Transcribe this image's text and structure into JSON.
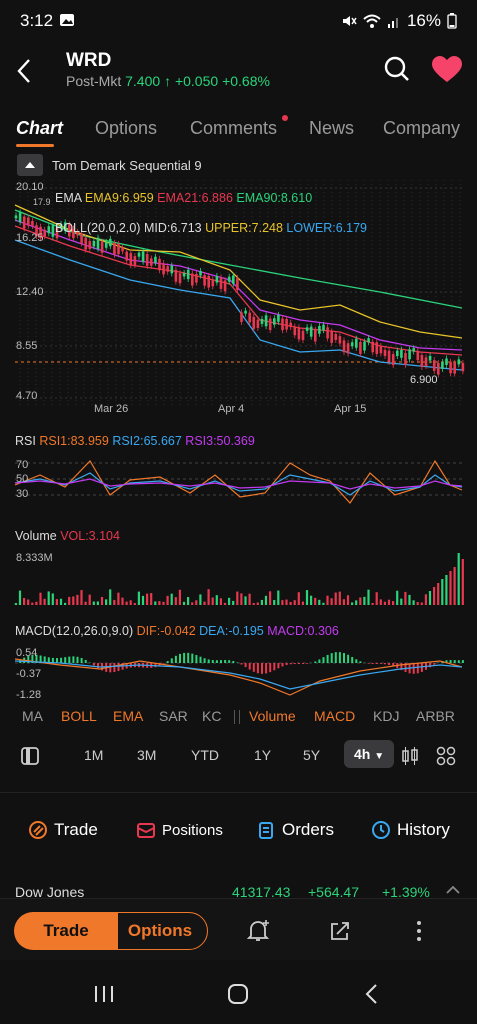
{
  "status_bar": {
    "time": "3:12",
    "battery": "16%"
  },
  "header": {
    "ticker": "WRD",
    "session_label": "Post-Mkt",
    "price": "7.400",
    "change": "+0.050",
    "change_pct": "+0.68%"
  },
  "tabs": [
    "Chart",
    "Options",
    "Comments",
    "News",
    "Company"
  ],
  "indicator_title": "Tom Demark Sequential 9",
  "main_chart": {
    "ema_label": "EMA",
    "ema9": "EMA9:6.959",
    "ema21": "EMA21:6.886",
    "ema90": "EMA90:8.610",
    "boll_label": "BOLL(20.0,2.0)",
    "boll_mid": "MID:6.713",
    "boll_upper": "UPPER:7.248",
    "boll_lower": "LOWER:6.179",
    "y_labels": [
      "20.10",
      "17.9",
      "16.25",
      "12.40",
      "8.55",
      "4.70"
    ],
    "price_marker": "6.900",
    "x_labels": [
      "Mar 26",
      "Apr 4",
      "Apr 15"
    ]
  },
  "rsi": {
    "label": "RSI",
    "rsi1": "RSI1:83.959",
    "rsi2": "RSI2:65.667",
    "rsi3": "RSI3:50.369",
    "y_labels": [
      "70",
      "50",
      "30"
    ]
  },
  "volume": {
    "label": "Volume",
    "vol": "VOL:3.104",
    "max_label": "8.333M"
  },
  "macd": {
    "label": "MACD(12.0,26.0,9.0)",
    "dif": "DIF:-0.042",
    "dea": "DEA:-0.195",
    "macd": "MACD:0.306",
    "y_labels": [
      "0.54",
      "-0.37",
      "-1.28"
    ]
  },
  "indicators": [
    "MA",
    "BOLL",
    "EMA",
    "SAR",
    "KC",
    "Volume",
    "MACD",
    "KDJ",
    "ARBR"
  ],
  "periods": [
    "1M",
    "3M",
    "YTD",
    "1Y",
    "5Y",
    "4h"
  ],
  "actions": [
    "Trade",
    "Positions",
    "Orders",
    "History"
  ],
  "index_row": {
    "name": "Dow Jones",
    "value": "41317.43",
    "change": "+564.47",
    "pct": "+1.39%"
  },
  "bottom": {
    "trade": "Trade",
    "options": "Options"
  },
  "colors": {
    "accent": "#f0782a",
    "up": "#2bd47a",
    "down": "#e8384f"
  }
}
